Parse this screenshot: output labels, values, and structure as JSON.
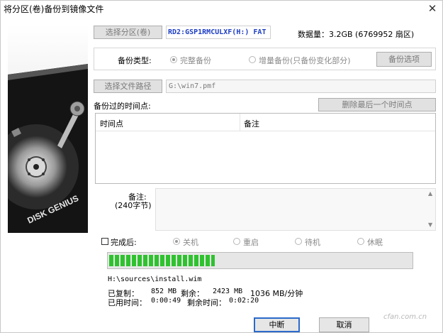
{
  "window": {
    "title": "将分区(卷)备份到镜像文件",
    "close_symbol": "✕"
  },
  "source": {
    "select_button": "选择分区(卷)",
    "partition_text": "RD2:GSP1RMCULXF(H:) FAT",
    "size_text": "数据量：3.2GB (6769952 扇区)"
  },
  "backup_type": {
    "label": "备份类型:",
    "options": [
      {
        "label": "完整备份",
        "selected": true
      },
      {
        "label": "增量备份(只备份变化部分)",
        "selected": false
      }
    ],
    "options_button": "备份选项"
  },
  "file": {
    "select_button": "选择文件路径",
    "path": "G:\\win7.pmf"
  },
  "timepoints": {
    "label": "备份过的时间点:",
    "delete_button": "删除最后一个时间点",
    "columns": [
      "时间点",
      "备注"
    ]
  },
  "note": {
    "label": "备注:",
    "sublabel": "(240字节)",
    "value": ""
  },
  "after": {
    "checkbox_label": "完成后:",
    "options": [
      "关机",
      "重启",
      "待机",
      "休眠"
    ]
  },
  "progress": {
    "fraction": 0.35
  },
  "status": {
    "current_file": "H:\\sources\\install.wim",
    "copied_label": "已复制：",
    "copied_value": "852 MB",
    "remaining_label": "剩余：",
    "remaining_value": "2423 MB",
    "speed": "1036 MB/分钟",
    "elapsed_label": "已用时间：",
    "elapsed_value": "0:00:49",
    "left_label": "剩余时间：",
    "left_value": "0:02:20"
  },
  "buttons": {
    "stop": "中断",
    "cancel": "取消"
  },
  "disk_image": {
    "brand_text": "DISK GENIUS"
  },
  "watermark": "cfan.com.cn",
  "colors": {
    "progress": "#2fc22f",
    "accent": "#1f3fc4"
  }
}
